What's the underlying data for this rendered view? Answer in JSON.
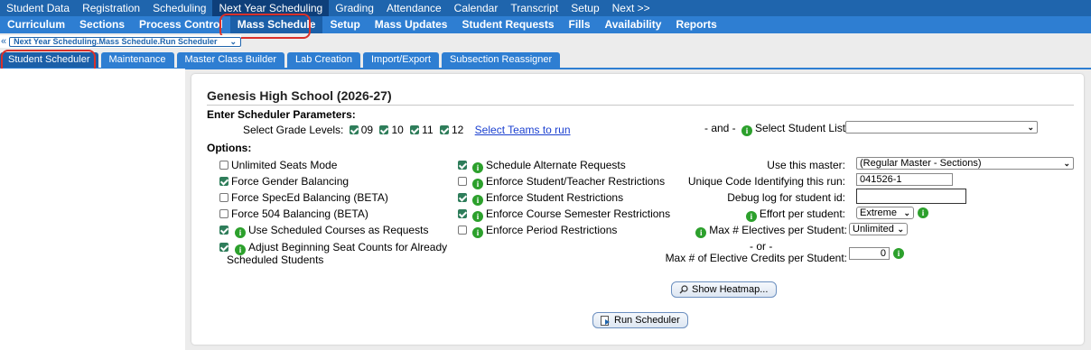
{
  "top_menu": [
    "Student Data",
    "Registration",
    "Scheduling",
    "Next Year Scheduling",
    "Grading",
    "Attendance",
    "Calendar",
    "Transcript",
    "Setup",
    "Next >>"
  ],
  "sub_menu": [
    "Curriculum",
    "Sections",
    "Process Control",
    "Mass Schedule",
    "Setup",
    "Mass Updates",
    "Student Requests",
    "Fills",
    "Availability",
    "Reports"
  ],
  "breadcrumb": {
    "arrows": "«",
    "label": "Next Year Scheduling.Mass Schedule.Run Scheduler",
    "chevron": "⌄"
  },
  "tabs": [
    "Student Scheduler",
    "Maintenance",
    "Master Class Builder",
    "Lab Creation",
    "Import/Export",
    "Subsection Reassigner"
  ],
  "panel": {
    "school_title": "Genesis High School (2026-27)",
    "params_heading": "Enter Scheduler Parameters:",
    "grade_label": "Select Grade Levels:",
    "grades": [
      "09",
      "10",
      "11",
      "12"
    ],
    "select_teams": "Select Teams to run",
    "and_label": "- and -",
    "select_student_list": "Select Student List:",
    "student_list_value": "",
    "options_heading": "Options:",
    "left_options": [
      {
        "label": "Unlimited Seats Mode",
        "checked": false,
        "info": false
      },
      {
        "label": "Force Gender Balancing",
        "checked": true,
        "info": false
      },
      {
        "label": "Force SpecEd Balancing (BETA)",
        "checked": false,
        "info": false
      },
      {
        "label": "Force 504 Balancing (BETA)",
        "checked": false,
        "info": false
      },
      {
        "label": "Use Scheduled Courses as Requests",
        "checked": true,
        "info": true
      },
      {
        "label": "Adjust Beginning Seat Counts for Already",
        "checked": true,
        "info": true
      }
    ],
    "left_option_cont": "Scheduled Students",
    "mid_options": [
      {
        "label": "Schedule Alternate Requests",
        "checked": true
      },
      {
        "label": "Enforce Student/Teacher Restrictions",
        "checked": false
      },
      {
        "label": "Enforce Student Restrictions",
        "checked": true
      },
      {
        "label": "Enforce Course Semester Restrictions",
        "checked": true
      },
      {
        "label": "Enforce Period Restrictions",
        "checked": false
      }
    ],
    "use_master_label": "Use this master:",
    "use_master_value": "(Regular Master - Sections)",
    "unique_code_label": "Unique Code Identifying this run:",
    "unique_code_value": "041526-1",
    "debug_label": "Debug log for student id:",
    "debug_value": "",
    "effort_label": "Effort per student:",
    "effort_value": "Extreme",
    "max_electives_label": "Max # Electives per Student:",
    "max_electives_value": "Unlimited",
    "or_label": "- or -",
    "max_credits_label": "Max # of Elective Credits per Student:",
    "max_credits_value": "0",
    "heatmap_button": "Show Heatmap...",
    "run_button": "Run Scheduler"
  },
  "colors": {
    "top_bar": "#1f65ad",
    "sub_bar": "#2e7ed2",
    "highlight_circle": "#d9302a",
    "info_icon": "#2ca02c"
  }
}
